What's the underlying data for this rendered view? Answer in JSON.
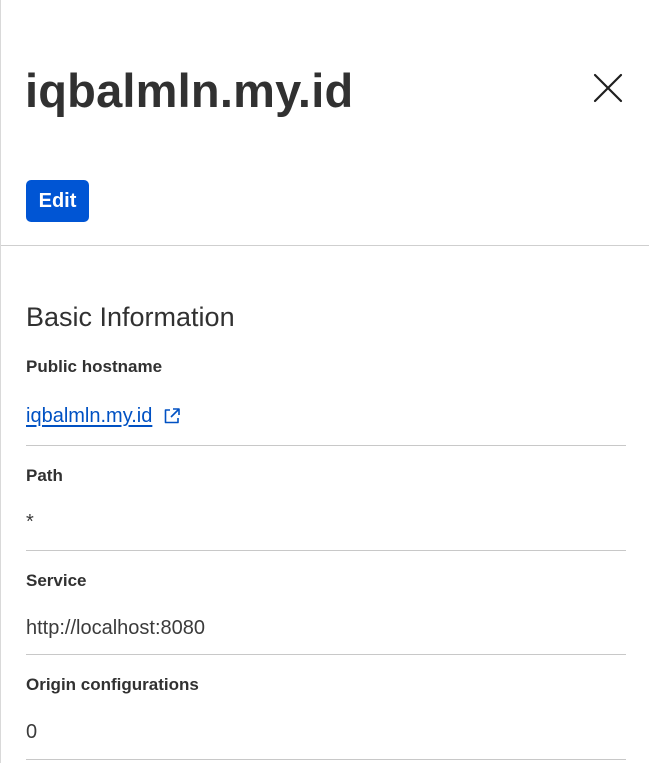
{
  "header": {
    "title": "iqbalmln.my.id",
    "edit_label": "Edit",
    "close_icon": "close-icon"
  },
  "basic_info": {
    "section_title": "Basic Information",
    "public_hostname": {
      "label": "Public hostname",
      "value": "iqbalmln.my.id",
      "icon": "external-link-icon"
    },
    "path": {
      "label": "Path",
      "value": "*"
    },
    "service": {
      "label": "Service",
      "value": "http://localhost:8080"
    },
    "origin_configurations": {
      "label": "Origin configurations",
      "value": "0"
    }
  },
  "colors": {
    "primary_button": "#0055d4",
    "link": "#0051c3",
    "text": "#313131",
    "divider": "#c8c8c8"
  }
}
